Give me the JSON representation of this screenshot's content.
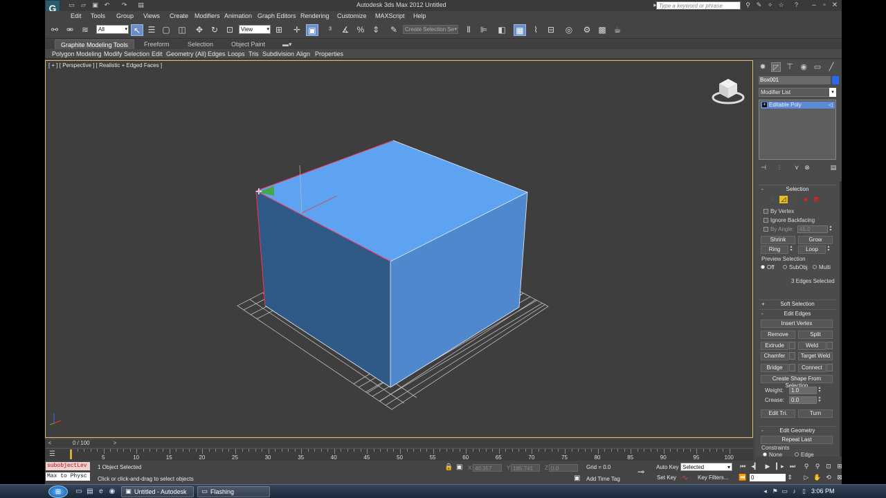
{
  "window": {
    "title": "Autodesk 3ds Max 2012     Untitled",
    "search_placeholder": "Type a keyword or phrase"
  },
  "menu": [
    "Edit",
    "Tools",
    "Group",
    "Views",
    "Create",
    "Modifiers",
    "Animation",
    "Graph Editors",
    "Rendering",
    "Customize",
    "MAXScript",
    "Help"
  ],
  "toolbar": {
    "filter_value": "All",
    "ref_coord_value": "View",
    "named_selection_placeholder": "Create Selection Se"
  },
  "ribbon": {
    "tabs": [
      "Graphite Modeling Tools",
      "Freeform",
      "Selection",
      "Object Paint"
    ],
    "panels": [
      "Polygon Modeling",
      "Modify Selection",
      "Edit",
      "Geometry (All)",
      "Edges",
      "Loops",
      "Tris",
      "Subdivision",
      "Align",
      "Properties"
    ]
  },
  "viewport": {
    "label": "[ + ] [ Perspective ] [ Realistic + Edged Faces ]"
  },
  "command_panel": {
    "object_name": "Box001",
    "object_color": "#2a6ae8",
    "modifier_list": "Modifier List",
    "stack_item": "Editable Poly",
    "stack_item_sign": "+",
    "selection": {
      "title": "Selection",
      "by_vertex": "By Vertex",
      "ignore_backfacing": "Ignore Backfacing",
      "by_angle": "By Angle:",
      "angle_value": "45.0",
      "shrink": "Shrink",
      "grow": "Grow",
      "ring": "Ring",
      "loop": "Loop",
      "preview_selection": "Preview Selection",
      "preview_off": "Off",
      "preview_subobj": "SubObj",
      "preview_multi": "Multi",
      "status": "3 Edges Selected"
    },
    "soft_selection": {
      "sign": "+",
      "title": "Soft Selection"
    },
    "edit_edges": {
      "sign": "-",
      "title": "Edit Edges",
      "insert_vertex": "Insert Vertex",
      "remove": "Remove",
      "split": "Split",
      "extrude": "Extrude",
      "weld": "Weld",
      "chamfer": "Chamfer",
      "target_weld": "Target Weld",
      "bridge": "Bridge",
      "connect": "Connect",
      "create_shape": "Create Shape From Selection",
      "weight_label": "Weight:",
      "weight_value": "1.0",
      "crease_label": "Crease:",
      "crease_value": "0.0",
      "edit_tri": "Edit Tri.",
      "turn": "Turn"
    },
    "edit_geometry": {
      "sign": "-",
      "title": "Edit Geometry",
      "repeat_last": "Repeat Last",
      "constraints": "Constraints",
      "none": "None",
      "edge": "Edge"
    }
  },
  "timeline": {
    "frame_label": "0 / 100",
    "current_frame": 0,
    "ticks": [
      "0",
      "5",
      "10",
      "15",
      "20",
      "25",
      "30",
      "35",
      "40",
      "45",
      "50",
      "55",
      "60",
      "65",
      "70",
      "75",
      "80",
      "85",
      "90",
      "95",
      "100"
    ]
  },
  "status": {
    "script_line1": "subobjectLev",
    "script_line2": "Max to Physc",
    "selection_status": "1 Object Selected",
    "prompt": "Click or click-and-drag to select objects",
    "x_label": "X:",
    "x_value": "40.357",
    "y_label": "Y:",
    "y_value": "185.741",
    "z_label": "Z:",
    "z_value": "0.0",
    "grid": "Grid = 0.0",
    "add_time_tag": "Add Time Tag",
    "auto_key": "Auto Key",
    "key_mode": "Selected",
    "set_key": "Set Key",
    "key_filters": "Key Filters...",
    "frame_value": "0"
  },
  "taskbar": {
    "task1": "Untitled - Autodesk ...",
    "task2": "Flashing",
    "clock": "3:06 PM"
  }
}
